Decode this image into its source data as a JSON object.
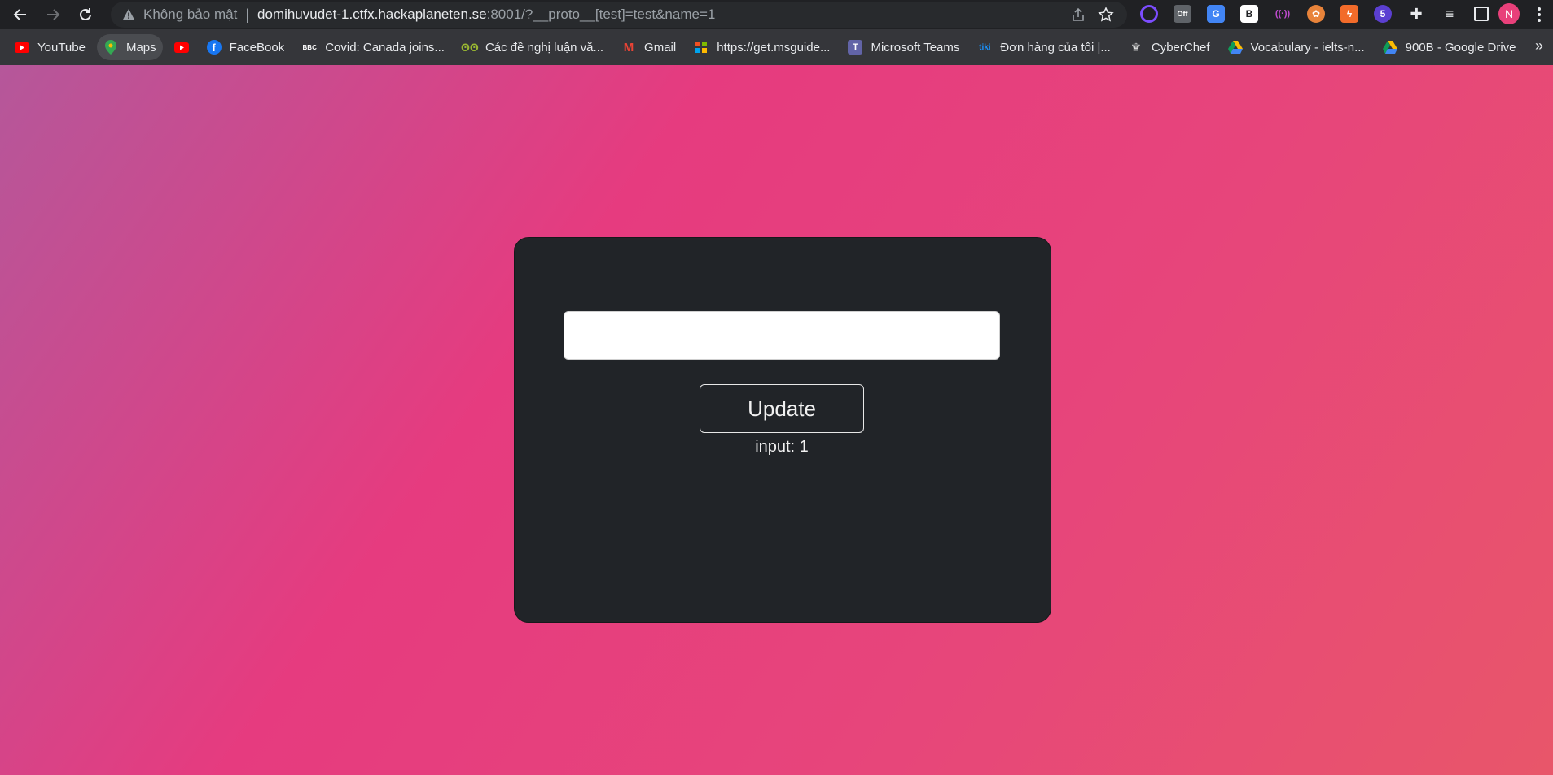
{
  "browser": {
    "security_label": "Không bảo mật",
    "url_host": "domihuvudet-1.ctfx.hackaplaneten.se",
    "url_rest": ":8001/?__proto__[test]=test&name=1",
    "profile_initial": "N",
    "extensions": [
      {
        "icon": "circle-extension-icon",
        "color": "#7c4dff",
        "text": "◎"
      },
      {
        "icon": "off-extension-icon",
        "color": "#5f6368",
        "text": "Off"
      },
      {
        "icon": "translate-extension-icon",
        "color": "#4285f4",
        "text": "G"
      },
      {
        "icon": "b-extension-icon",
        "color": "#ffffff",
        "text": "B"
      },
      {
        "icon": "broadcast-extension-icon",
        "color": "#c04bd0",
        "text": "((·))"
      },
      {
        "icon": "cookie-extension-icon",
        "color": "#e8833a",
        "text": "✿"
      },
      {
        "icon": "bolt-extension-icon",
        "color": "#f26b2a",
        "text": "ϟ"
      },
      {
        "icon": "hat-extension-icon",
        "color": "#5b3fd1",
        "text": "5"
      }
    ]
  },
  "bookmarks": [
    {
      "label": "YouTube",
      "icon": "youtube-icon",
      "color": "#ff0000"
    },
    {
      "label": "Maps",
      "icon": "maps-icon",
      "color": "#34a853",
      "active": true
    },
    {
      "label": "",
      "icon": "youtube-icon",
      "color": "#ff0000"
    },
    {
      "label": "FaceBook",
      "icon": "facebook-icon",
      "color": "#1877f2"
    },
    {
      "label": "Covid: Canada joins...",
      "icon": "bbc-icon",
      "color": "#ffffff"
    },
    {
      "label": "Các đề nghị luận vă...",
      "icon": "owl-icon",
      "color": "#9ab832"
    },
    {
      "label": "Gmail",
      "icon": "gmail-icon",
      "color": "#ea4335"
    },
    {
      "label": "https://get.msguide...",
      "icon": "grid-icon",
      "color": "#888888"
    },
    {
      "label": "Microsoft Teams",
      "icon": "teams-icon",
      "color": "#6264a7"
    },
    {
      "label": "Đơn hàng của tôi |...",
      "icon": "tiki-icon",
      "color": "#1a94ff"
    },
    {
      "label": "CyberChef",
      "icon": "chef-icon",
      "color": "#dddddd"
    },
    {
      "label": "Vocabulary - ielts-n...",
      "icon": "drive-icon",
      "color": "#fbbc04"
    },
    {
      "label": "900B - Google Drive",
      "icon": "drive-icon",
      "color": "#fbbc04"
    }
  ],
  "page": {
    "input_value": "",
    "update_label": "Update",
    "status_text": "input: 1"
  }
}
